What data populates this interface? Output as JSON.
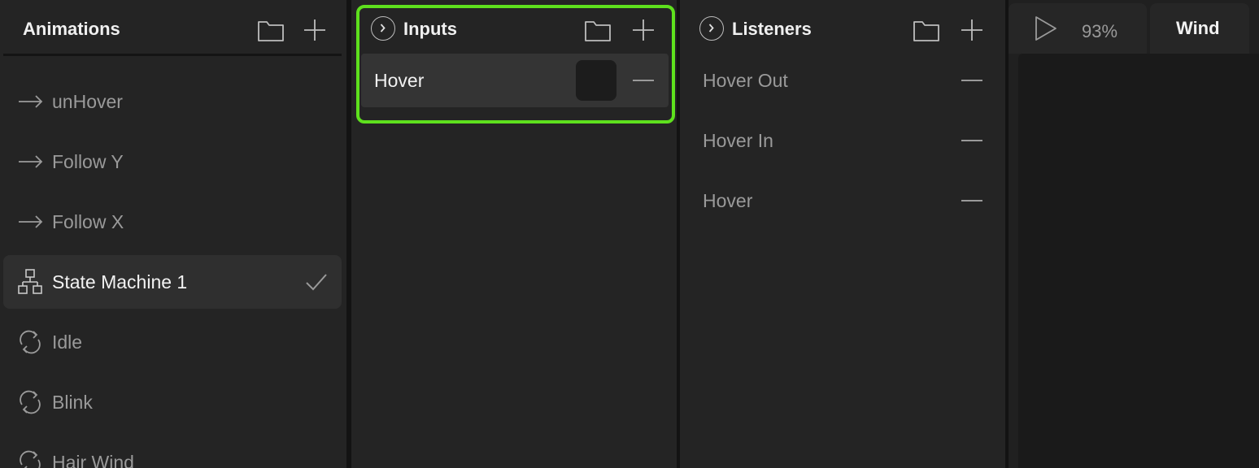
{
  "animations": {
    "title": "Animations",
    "items": [
      {
        "label": "unHover",
        "icon": "arrow-right-icon"
      },
      {
        "label": "Follow Y",
        "icon": "arrow-right-icon"
      },
      {
        "label": "Follow X",
        "icon": "arrow-right-icon"
      },
      {
        "label": "State Machine 1",
        "icon": "state-machine-icon",
        "selected": true
      },
      {
        "label": "Idle",
        "icon": "loop-icon"
      },
      {
        "label": "Blink",
        "icon": "loop-icon"
      },
      {
        "label": "Hair Wind",
        "icon": "loop-icon"
      }
    ]
  },
  "inputs": {
    "title": "Inputs",
    "items": [
      {
        "label": "Hover",
        "type": "boolean"
      }
    ]
  },
  "listeners": {
    "title": "Listeners",
    "items": [
      {
        "label": "Hover Out"
      },
      {
        "label": "Hover In"
      },
      {
        "label": "Hover"
      }
    ]
  },
  "viewer": {
    "zoom": "93%",
    "tab": "Wind"
  },
  "colors": {
    "highlight": "#5ee01d",
    "panel": "#242424",
    "selected_row": "#2f2f2f"
  }
}
